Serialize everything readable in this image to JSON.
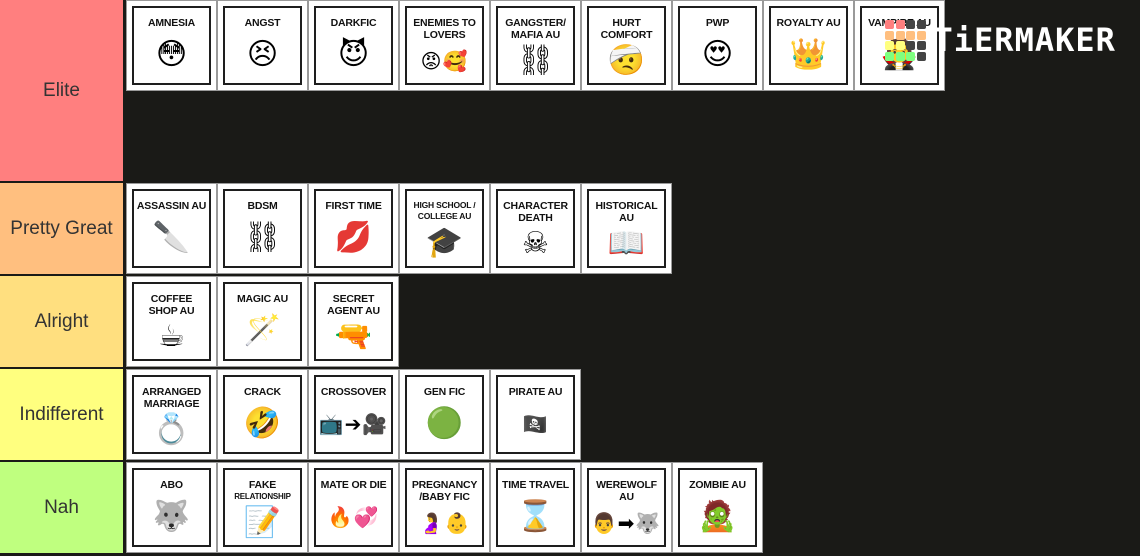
{
  "logo": {
    "text": "TiERMAKER",
    "grid_colors": [
      "#ff7f7f",
      "#ff7f7f",
      "#444444",
      "#444444",
      "#ffbf7f",
      "#ffbf7f",
      "#ffbf7f",
      "#ffbf7f",
      "#ffff7f",
      "#ffff7f",
      "#444444",
      "#444444",
      "#7fff7f",
      "#7fff7f",
      "#7fff7f",
      "#444444"
    ]
  },
  "tiers": [
    {
      "label": "Elite",
      "color": "#ff7f7f",
      "items": [
        {
          "title": "AMNESIA",
          "emoji": "😳",
          "icon": "astonished-face-icon"
        },
        {
          "title": "ANGST",
          "emoji": "😣",
          "icon": "persevering-face-icon"
        },
        {
          "title": "DARKFIC",
          "emoji": "😈",
          "icon": "smiling-devil-icon"
        },
        {
          "title": "ENEMIES TO LOVERS",
          "emoji": "😡🥰",
          "icon": "angry-and-loving-faces-icon"
        },
        {
          "title": "GANGSTER/ MAFIA AU",
          "emoji": "⛓",
          "icon": "chains-icon"
        },
        {
          "title": "HURT COMFORT",
          "emoji": "🤕",
          "icon": "bandaged-face-icon"
        },
        {
          "title": "PWP",
          "emoji": "😍",
          "icon": "heart-eyes-face-icon"
        },
        {
          "title": "ROYALTY AU",
          "emoji": "👑",
          "icon": "crown-icon"
        },
        {
          "title": "VAMPIRE AU",
          "emoji": "🧛",
          "icon": "vampire-icon"
        }
      ]
    },
    {
      "label": "Pretty Great",
      "color": "#ffbf7f",
      "items": [
        {
          "title": "ASSASSIN AU",
          "emoji": "🔪",
          "icon": "knife-icon"
        },
        {
          "title": "BDSM",
          "emoji": "⛓",
          "icon": "handcuffs-icon"
        },
        {
          "title": "FIRST TIME",
          "emoji": "💋",
          "icon": "kiss-mark-icon"
        },
        {
          "title": "HIGH SCHOOL / COLLEGE AU",
          "emoji": "🎓",
          "icon": "graduation-cap-icon",
          "small": true
        },
        {
          "title": "CHARACTER DEATH",
          "emoji": "☠",
          "icon": "skull-crossbones-icon"
        },
        {
          "title": "HISTORICAL AU",
          "emoji": "📖",
          "icon": "open-book-icon"
        }
      ]
    },
    {
      "label": "Alright",
      "color": "#ffdf7f",
      "items": [
        {
          "title": "COFFEE SHOP AU",
          "emoji": "☕",
          "icon": "coffee-cup-icon"
        },
        {
          "title": "MAGIC AU",
          "emoji": "🪄",
          "icon": "magic-wand-icon"
        },
        {
          "title": "SECRET AGENT AU",
          "emoji": "🔫",
          "icon": "pistol-icon"
        }
      ]
    },
    {
      "label": "Indifferent",
      "color": "#ffff7f",
      "items": [
        {
          "title": "ARRANGED MARRIAGE",
          "emoji": "💍",
          "icon": "ring-icon"
        },
        {
          "title": "CRACK",
          "emoji": "🤣",
          "icon": "rolling-laughing-face-icon"
        },
        {
          "title": "CROSSOVER",
          "emoji": "📺➔🎥",
          "icon": "tv-to-camera-icon"
        },
        {
          "title": "GEN FIC",
          "emoji": "🟢",
          "icon": "green-circle-icon"
        },
        {
          "title": "PIRATE AU",
          "emoji": "🏴‍☠️",
          "icon": "pirate-flag-icon"
        }
      ]
    },
    {
      "label": "Nah",
      "color": "#bfff7f",
      "items": [
        {
          "title": "ABO",
          "emoji": "🐺",
          "icon": "wolf-face-icon"
        },
        {
          "title": "FAKE RELATIONSHIP",
          "emoji": "📝",
          "icon": "memo-pencil-icon",
          "small_second": true
        },
        {
          "title": "MATE OR DIE",
          "emoji": "🔥💞",
          "icon": "fire-and-hearts-icon"
        },
        {
          "title": "PREGNANCY /BABY FIC",
          "emoji": "🤰👶",
          "icon": "pregnant-and-stroller-icon"
        },
        {
          "title": "TIME TRAVEL",
          "emoji": "⌛",
          "icon": "hourglass-icon"
        },
        {
          "title": "WEREWOLF AU",
          "emoji": "👨➡🐺",
          "icon": "man-to-wolf-icon"
        },
        {
          "title": "ZOMBIE AU",
          "emoji": "🧟",
          "icon": "zombie-icon"
        }
      ]
    }
  ]
}
